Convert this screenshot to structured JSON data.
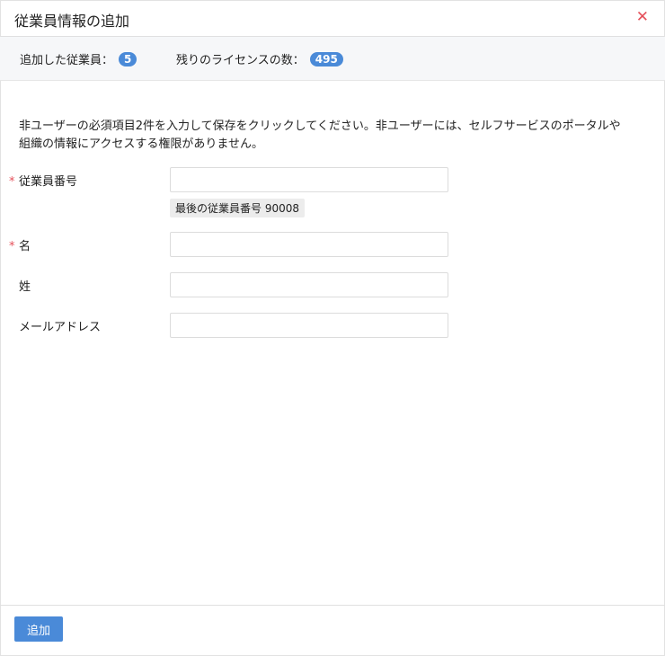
{
  "dialog": {
    "title": "従業員情報の追加",
    "close_icon": "close-icon"
  },
  "stats": {
    "added_label": "追加した従業員：",
    "added_count": "5",
    "remaining_label": "残りのライセンスの数：",
    "remaining_count": "495"
  },
  "intro": "非ユーザーの必須項目2件を入力して保存をクリックしてください。非ユーザーには、セルフサービスのポータルや組織の情報にアクセスする権限がありません。",
  "form": {
    "employee_id": {
      "required_mark": "*",
      "label": "従業員番号",
      "value": "",
      "hint": "最後の従業員番号 90008"
    },
    "first_name": {
      "required_mark": "*",
      "label": "名",
      "value": ""
    },
    "last_name": {
      "label": "姓",
      "value": ""
    },
    "email": {
      "label": "メールアドレス",
      "value": ""
    }
  },
  "footer": {
    "add_label": "追加"
  },
  "colors": {
    "accent": "#4a8ad8",
    "required": "#e5505a"
  }
}
